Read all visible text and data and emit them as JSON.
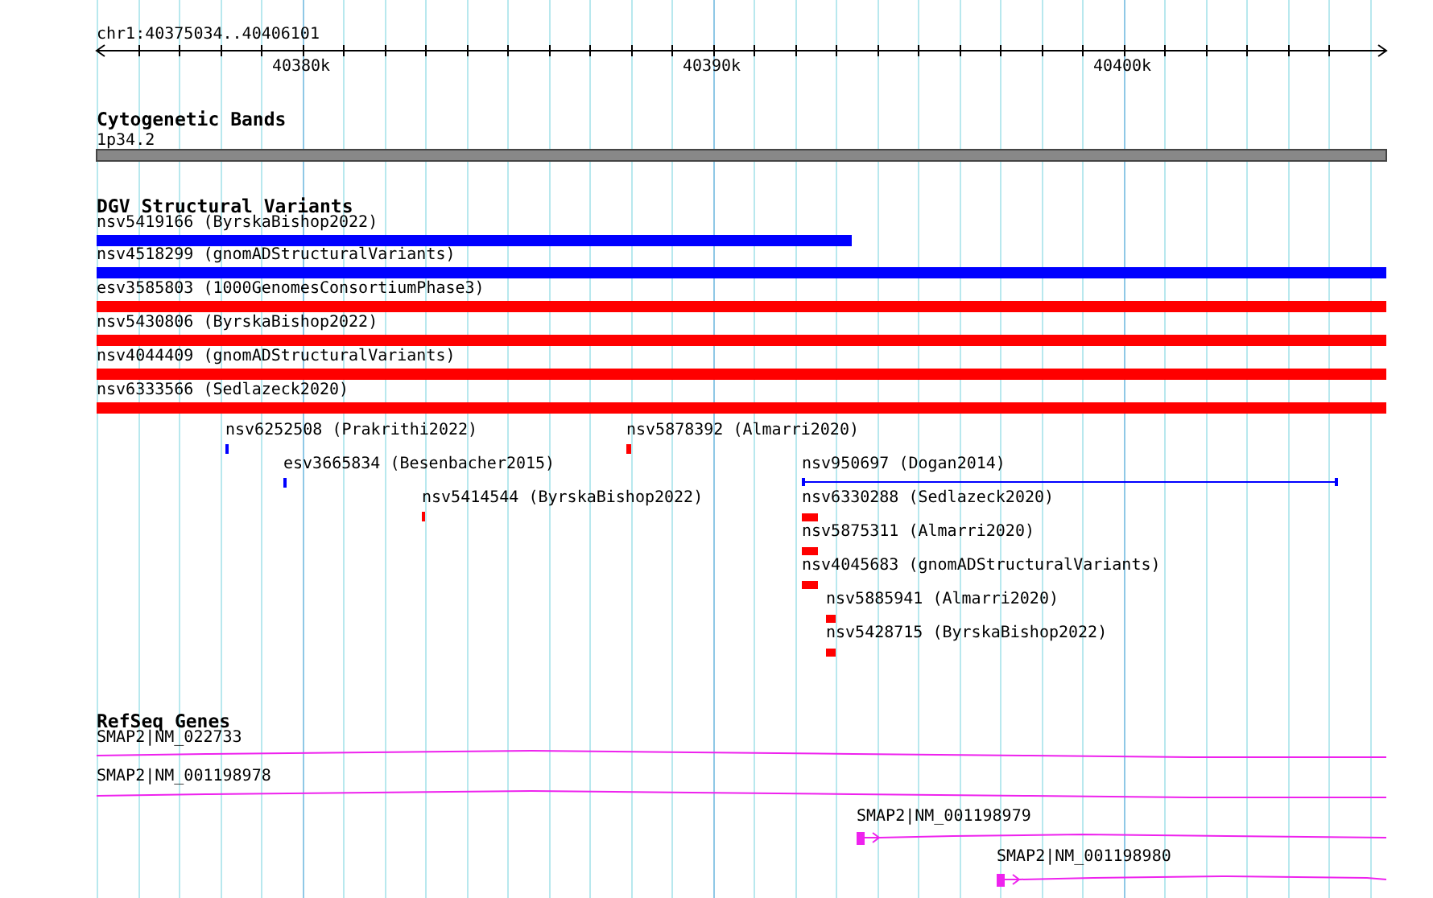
{
  "ruler": {
    "location": "chr1:40375034..40406101",
    "tick_labels": [
      "40380k",
      "40390k",
      "40400k"
    ]
  },
  "tracks": [
    {
      "kind": "cytoband",
      "title": "Cytogenetic Bands",
      "features": [
        {
          "label": "1p34.2"
        }
      ]
    },
    {
      "kind": "variants",
      "title": "DGV Structural Variants",
      "features": [
        {
          "label": "nsv5419166 (ByrskaBishop2022)",
          "color": "#0000ff"
        },
        {
          "label": "nsv4518299 (gnomADStructuralVariants)",
          "color": "#0000ff"
        },
        {
          "label": "esv3585803 (1000GenomesConsortiumPhase3)",
          "color": "#ff0000"
        },
        {
          "label": "nsv5430806 (ByrskaBishop2022)",
          "color": "#ff0000"
        },
        {
          "label": "nsv4044409 (gnomADStructuralVariants)",
          "color": "#ff0000"
        },
        {
          "label": "nsv6333566 (Sedlazeck2020)",
          "color": "#ff0000"
        },
        {
          "label": "nsv6252508 (Prakrithi2022)",
          "color": "#0000ff"
        },
        {
          "label": "nsv5878392 (Almarri2020)",
          "color": "#ff0000"
        },
        {
          "label": "esv3665834 (Besenbacher2015)",
          "color": "#0000ff"
        },
        {
          "label": "nsv950697 (Dogan2014)",
          "color": "#0000ff"
        },
        {
          "label": "nsv5414544 (ByrskaBishop2022)",
          "color": "#ff0000"
        },
        {
          "label": "nsv6330288 (Sedlazeck2020)",
          "color": "#ff0000"
        },
        {
          "label": "nsv5875311 (Almarri2020)",
          "color": "#ff0000"
        },
        {
          "label": "nsv4045683 (gnomADStructuralVariants)",
          "color": "#ff0000"
        },
        {
          "label": "nsv5885941 (Almarri2020)",
          "color": "#ff0000"
        },
        {
          "label": "nsv5428715 (ByrskaBishop2022)",
          "color": "#ff0000"
        }
      ]
    },
    {
      "kind": "genes",
      "title": "RefSeq Genes",
      "features": [
        {
          "label": "SMAP2|NM_022733"
        },
        {
          "label": "SMAP2|NM_001198978"
        },
        {
          "label": "SMAP2|NM_001198979"
        },
        {
          "label": "SMAP2|NM_001198980"
        }
      ]
    }
  ]
}
